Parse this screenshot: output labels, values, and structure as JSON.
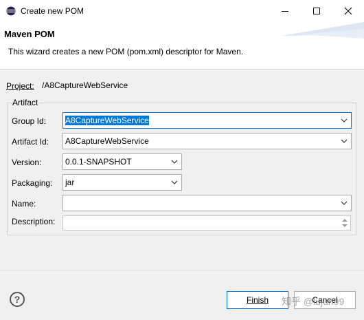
{
  "window": {
    "title": "Create new POM"
  },
  "banner": {
    "title": "Maven POM",
    "description": "This wizard creates a new POM (pom.xml) descriptor for Maven."
  },
  "project": {
    "label": "Project:",
    "value": "/A8CaptureWebService"
  },
  "artifact": {
    "legend": "Artifact",
    "group_id": {
      "label": "Group Id:",
      "value": "A8CaptureWebService"
    },
    "artifact_id": {
      "label": "Artifact Id:",
      "value": "A8CaptureWebService"
    },
    "version": {
      "label": "Version:",
      "value": "0.0.1-SNAPSHOT"
    },
    "packaging": {
      "label": "Packaging:",
      "value": "jar"
    },
    "name": {
      "label": "Name:",
      "value": ""
    },
    "description": {
      "label": "Description:",
      "value": ""
    }
  },
  "buttons": {
    "help": "?",
    "finish": "Finish",
    "cancel": "Cancel"
  },
  "watermark": "知乎 @lujun99",
  "colors": {
    "accent": "#0078d7",
    "background": "#f0f0f0"
  }
}
